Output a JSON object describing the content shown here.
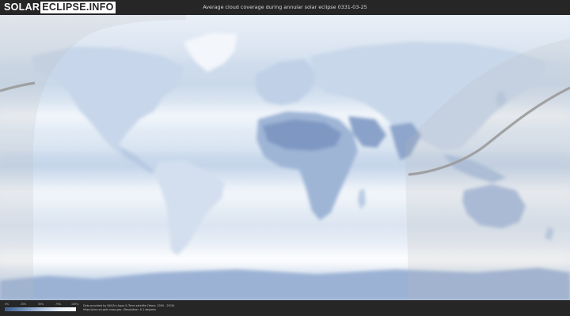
{
  "header": {
    "logo_solar": "SOLAR",
    "logo_boxed": "ECLIPSE.INFO",
    "title": "Average cloud coverage during annular solar eclipse 0331-03-25"
  },
  "legend": {
    "ticks": [
      "0%",
      "25%",
      "50%",
      "75%",
      "100%"
    ],
    "colors": [
      "#3f5f8e",
      "#6f8db8",
      "#a9bfdc",
      "#e3ebf5",
      "#ffffff"
    ]
  },
  "footer": {
    "credit_line_1": "Data provided by NASA's Aqua & Terra satellite (Years: 2000 - 2019)",
    "credit_line_2": "https://neo.sci.gsfc.nasa.gov | Resolution: 0.1 degrees"
  },
  "map": {
    "projection": "equirectangular world map",
    "central_line_color": "#9a9a9a",
    "shadow_zone_color": "#c8c8c8"
  }
}
